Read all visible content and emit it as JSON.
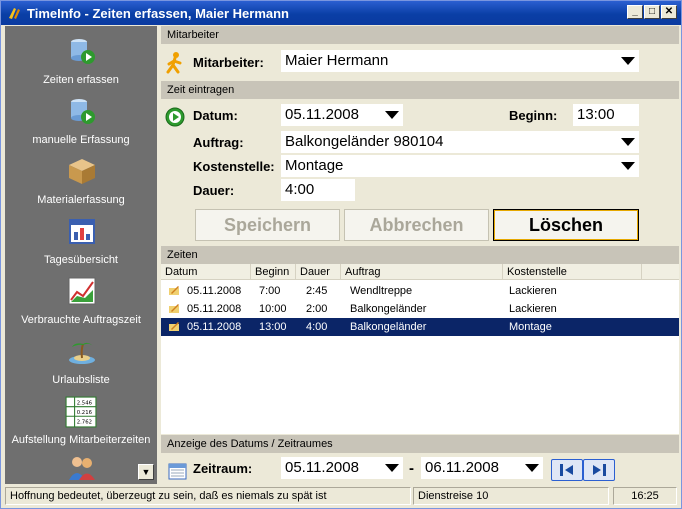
{
  "window": {
    "title": "TimeInfo - Zeiten erfassen, Maier Hermann"
  },
  "sidebar": {
    "items": [
      {
        "label": "Zeiten erfassen",
        "icon": "db-play-icon"
      },
      {
        "label": "manuelle Erfassung",
        "icon": "db-play-icon"
      },
      {
        "label": "Materialerfassung",
        "icon": "box-icon"
      },
      {
        "label": "Tagesübersicht",
        "icon": "calendar-chart-icon"
      },
      {
        "label": "Verbrauchte Auftragszeit",
        "icon": "line-chart-icon"
      },
      {
        "label": "Urlaubsliste",
        "icon": "island-icon"
      },
      {
        "label": "Aufstellung Mitarbeiterzeiten",
        "icon": "table-icon",
        "values": [
          "2.546",
          "0.216",
          "2.762"
        ]
      }
    ]
  },
  "mitarbeiter": {
    "section_title": "Mitarbeiter",
    "label": "Mitarbeiter:",
    "value": "Maier Hermann"
  },
  "zeit": {
    "section_title": "Zeit eintragen",
    "datum_label": "Datum:",
    "datum_value": "05.11.2008",
    "beginn_label": "Beginn:",
    "beginn_value": "13:00",
    "auftrag_label": "Auftrag:",
    "auftrag_value": "Balkongeländer 980104",
    "kostenstelle_label": "Kostenstelle:",
    "kostenstelle_value": "Montage",
    "dauer_label": "Dauer:",
    "dauer_value": "4:00",
    "buttons": {
      "save": "Speichern",
      "cancel": "Abbrechen",
      "delete": "Löschen"
    }
  },
  "zeiten": {
    "section_title": "Zeiten",
    "columns": [
      "Datum",
      "Beginn",
      "Dauer",
      "Auftrag",
      "Kostenstelle"
    ],
    "rows": [
      {
        "datum": "05.11.2008",
        "beginn": "7:00",
        "dauer": "2:45",
        "auftrag": "Wendltreppe",
        "kostenstelle": "Lackieren"
      },
      {
        "datum": "05.11.2008",
        "beginn": "10:00",
        "dauer": "2:00",
        "auftrag": "Balkongeländer",
        "kostenstelle": "Lackieren"
      },
      {
        "datum": "05.11.2008",
        "beginn": "13:00",
        "dauer": "4:00",
        "auftrag": "Balkongeländer",
        "kostenstelle": "Montage",
        "selected": true
      }
    ]
  },
  "zeitraum": {
    "section_title": "Anzeige des Datums / Zeitraumes",
    "label": "Zeitraum:",
    "from": "05.11.2008",
    "separator": "-",
    "to": "06.11.2008"
  },
  "statusbar": {
    "message": "Hoffnung bedeutet, überzeugt zu sein, daß es niemals zu spät ist",
    "info": "Dienstreise 10",
    "time": "16:25"
  },
  "colors": {
    "selection": "#0b2567",
    "sidebar": "#6f6f6f",
    "title": "#0a3fa6"
  }
}
